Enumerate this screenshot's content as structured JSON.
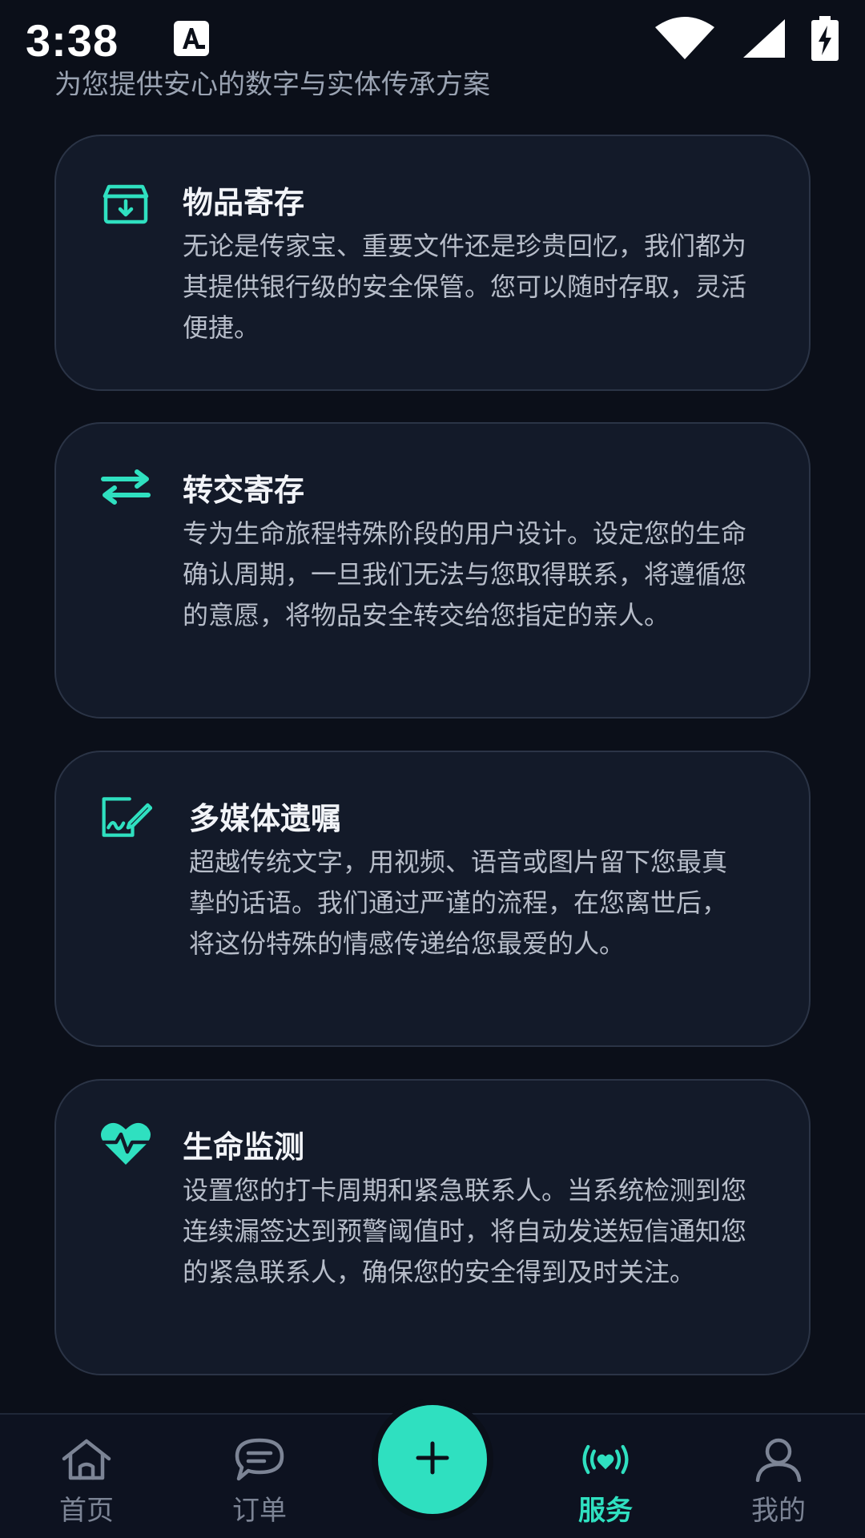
{
  "status_bar": {
    "time": "3:38",
    "notification_icon": "font-a-icon",
    "wifi_icon": "wifi-icon",
    "signal_icon": "cell-signal-icon",
    "battery_icon": "battery-charging-icon"
  },
  "header": {
    "subtitle": "为您提供安心的数字与实体传承方案"
  },
  "services": [
    {
      "icon": "archive-download-icon",
      "title": "物品寄存",
      "description": "无论是传家宝、重要文件还是珍贵回忆，我们都为其提供银行级的安全保管。您可以随时存取，灵活便捷。"
    },
    {
      "icon": "transfer-arrows-icon",
      "title": "转交寄存",
      "description": "专为生命旅程特殊阶段的用户设计。设定您的生命确认周期，一旦我们无法与您取得联系，将遵循您的意愿，将物品安全转交给您指定的亲人。"
    },
    {
      "icon": "signature-document-icon",
      "title": "多媒体遗嘱",
      "description": "超越传统文字，用视频、语音或图片留下您最真挚的话语。我们通过严谨的流程，在您离世后，将这份特殊的情感传递给您最爱的人。"
    },
    {
      "icon": "heart-pulse-icon",
      "title": "生命监测",
      "description": "设置您的打卡周期和紧急联系人。当系统检测到您连续漏签达到预警阈值时，将自动发送短信通知您的紧急联系人，确保您的安全得到及时关注。"
    }
  ],
  "bottom_nav": {
    "items": [
      {
        "label": "首页",
        "icon": "home-icon",
        "active": false
      },
      {
        "label": "订单",
        "icon": "chat-bubble-icon",
        "active": false
      },
      {
        "label": "服务",
        "icon": "broadcast-heart-icon",
        "active": true
      },
      {
        "label": "我的",
        "icon": "user-icon",
        "active": false
      }
    ],
    "fab_icon": "plus-icon"
  },
  "colors": {
    "accent": "#2fe0c0",
    "background": "#0b0f19",
    "card": "#131a29",
    "card_border": "#2b3446",
    "text_primary": "#f2f4f8",
    "text_secondary": "#b7bdc9",
    "nav_inactive": "#7c8495"
  }
}
